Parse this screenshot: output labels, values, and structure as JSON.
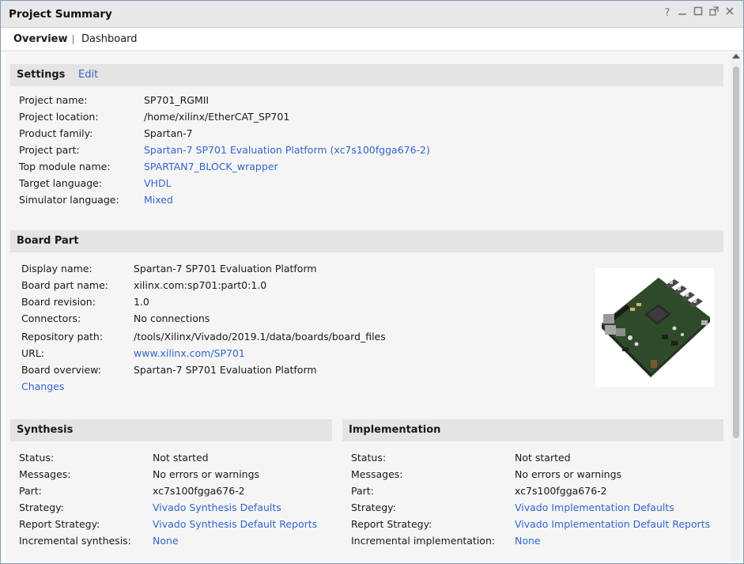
{
  "window": {
    "title": "Project Summary"
  },
  "tabs": [
    {
      "label": "Overview"
    },
    {
      "label": "Dashboard"
    }
  ],
  "window_controls": {
    "help": "?",
    "minimize": "_",
    "maximize": "□",
    "float": "⇱",
    "close": "✕"
  },
  "settings": {
    "title": "Settings",
    "edit_label": "Edit",
    "rows": [
      {
        "label": "Project name:",
        "value": "SP701_RGMII"
      },
      {
        "label": "Project location:",
        "value": "/home/xilinx/EtherCAT_SP701"
      },
      {
        "label": "Product family:",
        "value": "Spartan-7"
      },
      {
        "label": "Project part:",
        "value": "Spartan-7 SP701 Evaluation Platform (xc7s100fgga676-2)"
      },
      {
        "label": "Top module name:",
        "value": "SPARTAN7_BLOCK_wrapper"
      },
      {
        "label": "Target language:",
        "value": "VHDL"
      },
      {
        "label": "Simulator language:",
        "value": "Mixed"
      }
    ]
  },
  "board_part": {
    "title": "Board Part",
    "rows": [
      {
        "label": "Display name:",
        "value": "Spartan-7 SP701 Evaluation Platform"
      },
      {
        "label": "Board part name:",
        "value": "xilinx.com:sp701:part0:1.0"
      },
      {
        "label": "Board revision:",
        "value": "1.0"
      },
      {
        "label": "Connectors:",
        "value": "No connections"
      },
      {
        "label": "Repository path:",
        "value": "/tools/Xilinx/Vivado/2019.1/data/boards/board_files"
      },
      {
        "label": "URL:",
        "value": "www.xilinx.com/SP701"
      },
      {
        "label": "Board overview:",
        "value": "Spartan-7 SP701 Evaluation Platform"
      }
    ],
    "changes_label": "Changes"
  },
  "synthesis": {
    "title": "Synthesis",
    "rows": [
      {
        "label": "Status:",
        "value": "Not started"
      },
      {
        "label": "Messages:",
        "value": "No errors or warnings"
      },
      {
        "label": "Part:",
        "value": "xc7s100fgga676-2"
      },
      {
        "label": "Strategy:",
        "value": "Vivado Synthesis Defaults"
      },
      {
        "label": "Report Strategy:",
        "value": "Vivado Synthesis Default Reports"
      },
      {
        "label": "Incremental synthesis:",
        "value": "None"
      }
    ]
  },
  "implementation": {
    "title": "Implementation",
    "rows": [
      {
        "label": "Status:",
        "value": "Not started"
      },
      {
        "label": "Messages:",
        "value": "No errors or warnings"
      },
      {
        "label": "Part:",
        "value": "xc7s100fgga676-2"
      },
      {
        "label": "Strategy:",
        "value": "Vivado Implementation Defaults"
      },
      {
        "label": "Report Strategy:",
        "value": "Vivado Implementation Default Reports"
      },
      {
        "label": "Incremental implementation:",
        "value": "None"
      }
    ]
  },
  "colors": {
    "link": "#3366cc",
    "section_bg": "#e4e4e4",
    "content_bg": "#f5f5f5",
    "pcb_green": "#2f4a2a"
  },
  "icons": {
    "board_image": "sp701-board-image",
    "help": "help-icon",
    "minimize": "minimize-icon",
    "maximize": "maximize-icon",
    "float": "float-icon",
    "close": "close-icon"
  }
}
